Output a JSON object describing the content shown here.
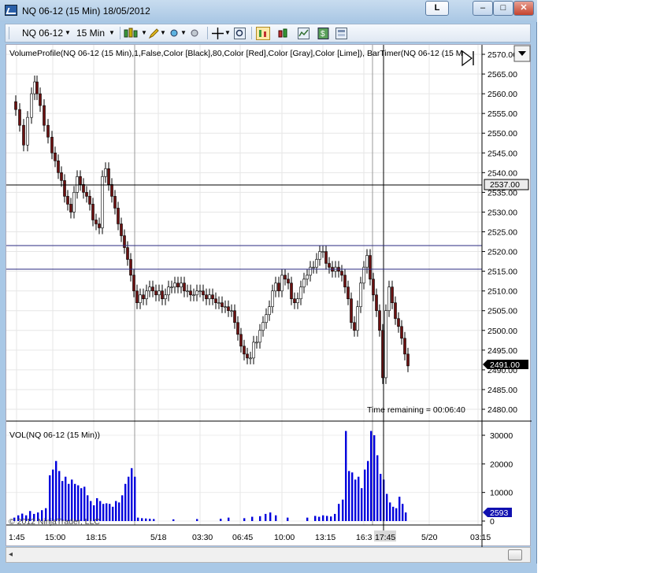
{
  "window": {
    "title": "NQ 06-12 (15 Min)  18/05/2012",
    "link_label": "L"
  },
  "toolbar": {
    "instrument": "NQ 06-12",
    "interval": "15 Min"
  },
  "indicators": {
    "price_label": "VolumeProfile(NQ 06-12 (15 Min),1,False,Color [Black],80,Color [Red],Color [Gray],Color [Lime]), BarTimer(NQ 06-12 (15 M",
    "volume_label": "VOL(NQ 06-12 (15 Min))",
    "time_remaining": "Time remaining = 00:06:40",
    "copyright": "© 2012 NinjaTrader, LLC"
  },
  "price_axis": [
    "2570.00",
    "2565.00",
    "2560.00",
    "2555.00",
    "2550.00",
    "2545.00",
    "2540.00",
    "2535.00",
    "2530.00",
    "2525.00",
    "2520.00",
    "2515.00",
    "2510.00",
    "2505.00",
    "2500.00",
    "2495.00",
    "2490.00",
    "2485.00",
    "2480.00"
  ],
  "price_markers": {
    "crosshair": "2537.00",
    "last": "2491.00"
  },
  "volume_axis": [
    "30000",
    "20000",
    "10000",
    "0"
  ],
  "volume_marker": "2593",
  "time_axis": [
    "1:45",
    "15:00",
    "18:15",
    "5/18",
    "03:30",
    "06:45",
    "10:00",
    "13:15",
    "16:3",
    "17:45",
    "5/20",
    "03:15"
  ],
  "colors": {
    "up_fill": "#ffffff",
    "down_fill": "#6b1010",
    "volume": "#0000dd",
    "level_line": "#2a2a80",
    "last_bg": "#000000",
    "volume_marker_bg": "#1010b0"
  },
  "icons": [
    "link-icon",
    "minimize-icon",
    "maximize-icon",
    "close-icon",
    "dropdown-arrow-icon",
    "bar-style-icon",
    "pencil-icon",
    "crosshair-icon",
    "zoom-icon",
    "chart-properties-icon",
    "data-series-icon",
    "strategies-icon",
    "indicators-icon",
    "scroll-end-icon",
    "chevron-down-icon"
  ]
}
